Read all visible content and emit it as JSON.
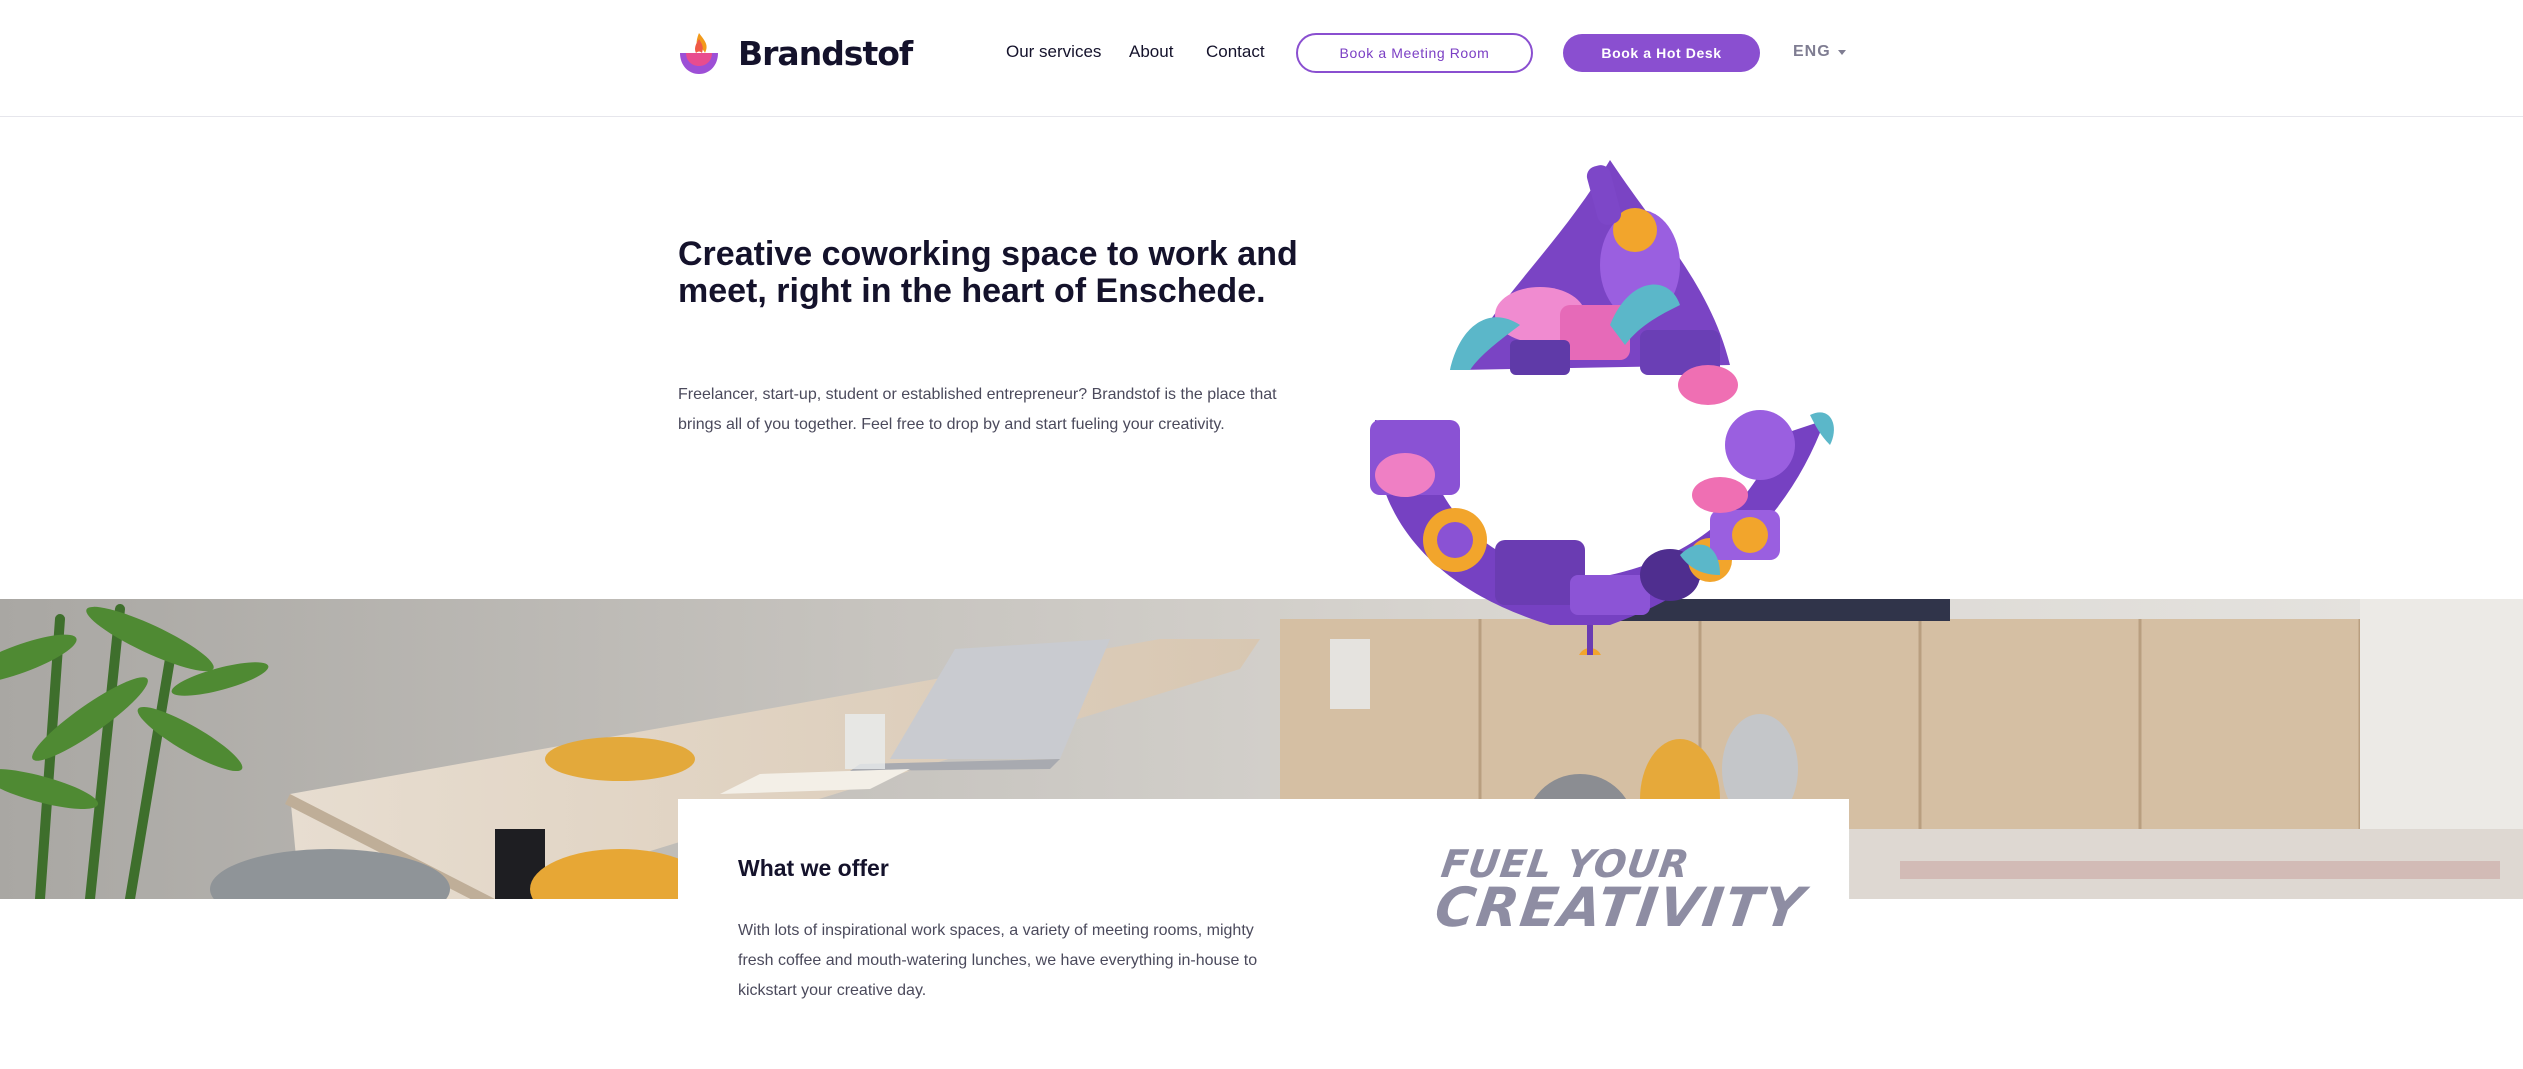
{
  "header": {
    "brand": "Brandstof",
    "nav": [
      {
        "label": "Our services"
      },
      {
        "label": "About"
      },
      {
        "label": "Contact"
      }
    ],
    "cta_outline": "Book a Meeting Room",
    "cta_solid": "Book a Hot Desk",
    "language": "ENG"
  },
  "hero": {
    "title": "Creative coworking space to work and meet, right in the heart of Enschede.",
    "text": "Freelancer, start-up, student or established entrepreneur? Brandstof is the place that brings all of you together. Feel free to drop by and start fueling your creativity."
  },
  "offer": {
    "title": "What we offer",
    "text": "With lots of inspirational work spaces, a variety of meeting rooms, mighty fresh coffee and mouth-watering lunches, we have everything in-house to kickstart your creative day.",
    "tagline_1": "FUEL YOUR",
    "tagline_2": "CREATIVITY"
  },
  "colors": {
    "accent": "#8a4fd0",
    "text_dark": "#14122b",
    "text_body": "#4b4a5c",
    "tagline": "#8e8da3"
  },
  "icons": {
    "logo": "flame-cup-icon",
    "language_caret": "chevron-down-icon"
  }
}
